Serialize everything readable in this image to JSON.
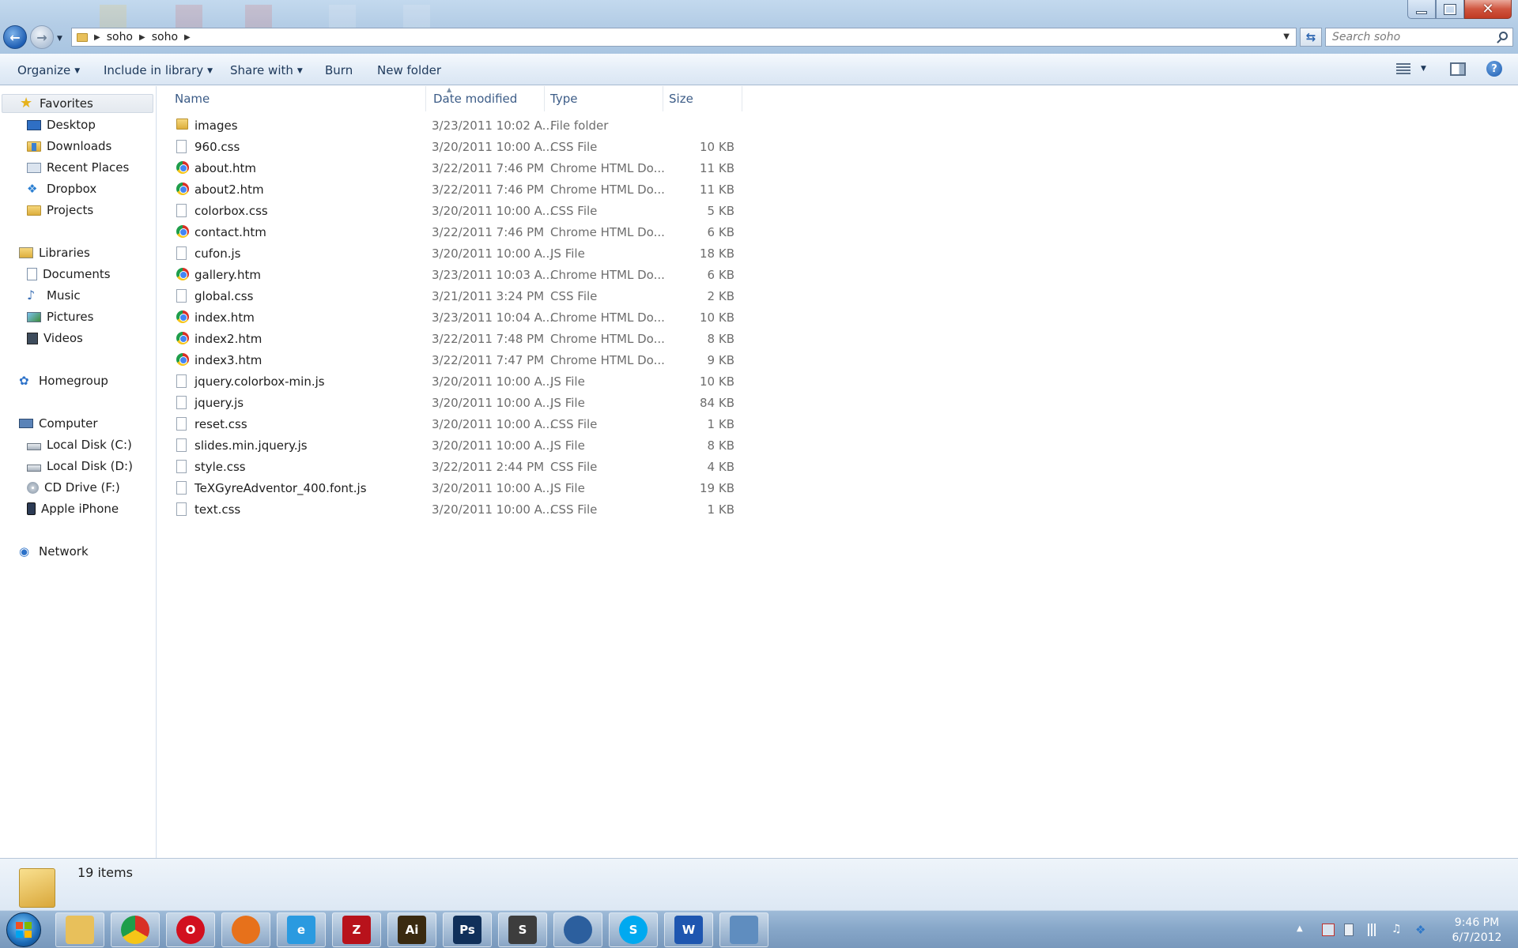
{
  "window": {
    "minimize_icon": "minimize-icon",
    "maximize_icon": "maximize-icon",
    "close_icon": "close-icon"
  },
  "address": {
    "crumbs": [
      "soho",
      "soho"
    ],
    "search_placeholder": "Search soho"
  },
  "toolbar": {
    "organize": "Organize",
    "include_in_library": "Include in library",
    "share_with": "Share with",
    "burn": "Burn",
    "new_folder": "New folder"
  },
  "nav": {
    "favorites": {
      "label": "Favorites",
      "items": [
        "Desktop",
        "Downloads",
        "Recent Places",
        "Dropbox",
        "Projects"
      ]
    },
    "libraries": {
      "label": "Libraries",
      "items": [
        "Documents",
        "Music",
        "Pictures",
        "Videos"
      ]
    },
    "homegroup": "Homegroup",
    "computer": {
      "label": "Computer",
      "items": [
        "Local Disk (C:)",
        "Local Disk (D:)",
        "CD Drive (F:)",
        "Apple iPhone"
      ]
    },
    "network": "Network"
  },
  "columns": {
    "name": "Name",
    "date_modified": "Date modified",
    "type": "Type",
    "size": "Size"
  },
  "files": [
    {
      "name": "images",
      "date": "3/23/2011 10:02 A...",
      "type": "File folder",
      "size": "",
      "icon": "folder-icon"
    },
    {
      "name": "960.css",
      "date": "3/20/2011 10:00 A...",
      "type": "CSS File",
      "size": "10 KB",
      "icon": "file-icon"
    },
    {
      "name": "about.htm",
      "date": "3/22/2011 7:46 PM",
      "type": "Chrome HTML Do...",
      "size": "11 KB",
      "icon": "chrome-icon"
    },
    {
      "name": "about2.htm",
      "date": "3/22/2011 7:46 PM",
      "type": "Chrome HTML Do...",
      "size": "11 KB",
      "icon": "chrome-icon"
    },
    {
      "name": "colorbox.css",
      "date": "3/20/2011 10:00 A...",
      "type": "CSS File",
      "size": "5 KB",
      "icon": "file-icon"
    },
    {
      "name": "contact.htm",
      "date": "3/22/2011 7:46 PM",
      "type": "Chrome HTML Do...",
      "size": "6 KB",
      "icon": "chrome-icon"
    },
    {
      "name": "cufon.js",
      "date": "3/20/2011 10:00 A...",
      "type": "JS File",
      "size": "18 KB",
      "icon": "file-icon"
    },
    {
      "name": "gallery.htm",
      "date": "3/23/2011 10:03 A...",
      "type": "Chrome HTML Do...",
      "size": "6 KB",
      "icon": "chrome-icon"
    },
    {
      "name": "global.css",
      "date": "3/21/2011 3:24 PM",
      "type": "CSS File",
      "size": "2 KB",
      "icon": "file-icon"
    },
    {
      "name": "index.htm",
      "date": "3/23/2011 10:04 A...",
      "type": "Chrome HTML Do...",
      "size": "10 KB",
      "icon": "chrome-icon"
    },
    {
      "name": "index2.htm",
      "date": "3/22/2011 7:48 PM",
      "type": "Chrome HTML Do...",
      "size": "8 KB",
      "icon": "chrome-icon"
    },
    {
      "name": "index3.htm",
      "date": "3/22/2011 7:47 PM",
      "type": "Chrome HTML Do...",
      "size": "9 KB",
      "icon": "chrome-icon"
    },
    {
      "name": "jquery.colorbox-min.js",
      "date": "3/20/2011 10:00 A...",
      "type": "JS File",
      "size": "10 KB",
      "icon": "file-icon"
    },
    {
      "name": "jquery.js",
      "date": "3/20/2011 10:00 A...",
      "type": "JS File",
      "size": "84 KB",
      "icon": "file-icon"
    },
    {
      "name": "reset.css",
      "date": "3/20/2011 10:00 A...",
      "type": "CSS File",
      "size": "1 KB",
      "icon": "file-icon"
    },
    {
      "name": "slides.min.jquery.js",
      "date": "3/20/2011 10:00 A...",
      "type": "JS File",
      "size": "8 KB",
      "icon": "file-icon"
    },
    {
      "name": "style.css",
      "date": "3/22/2011 2:44 PM",
      "type": "CSS File",
      "size": "4 KB",
      "icon": "file-icon"
    },
    {
      "name": "TeXGyreAdventor_400.font.js",
      "date": "3/20/2011 10:00 A...",
      "type": "JS File",
      "size": "19 KB",
      "icon": "file-icon"
    },
    {
      "name": "text.css",
      "date": "3/20/2011 10:00 A...",
      "type": "CSS File",
      "size": "1 KB",
      "icon": "file-icon"
    }
  ],
  "status": {
    "item_count": "19 items"
  },
  "taskbar": {
    "apps": [
      {
        "name": "explorer-icon",
        "color": "#e8c05b",
        "glyph": ""
      },
      {
        "name": "chrome-icon",
        "color": "#2f7a3a",
        "glyph": ""
      },
      {
        "name": "opera-icon",
        "color": "#d2101f",
        "glyph": "O"
      },
      {
        "name": "firefox-icon",
        "color": "#e7711b",
        "glyph": ""
      },
      {
        "name": "internet-explorer-icon",
        "color": "#2a9ae0",
        "glyph": "e"
      },
      {
        "name": "filezilla-icon",
        "color": "#b8121b",
        "glyph": "Z"
      },
      {
        "name": "illustrator-icon",
        "color": "#3a2a10",
        "glyph": "Ai"
      },
      {
        "name": "photoshop-icon",
        "color": "#10305a",
        "glyph": "Ps"
      },
      {
        "name": "sublime-icon",
        "color": "#3d3d3d",
        "glyph": "S"
      },
      {
        "name": "thunderbird-icon",
        "color": "#2c5f9e",
        "glyph": ""
      },
      {
        "name": "skype-icon",
        "color": "#00a9f0",
        "glyph": "S"
      },
      {
        "name": "word-icon",
        "color": "#1e56b0",
        "glyph": "W"
      },
      {
        "name": "photo-viewer-icon",
        "color": "#5f8dbf",
        "glyph": ""
      }
    ],
    "time": "9:46 PM",
    "date": "6/7/2012"
  },
  "colors": {
    "accent": "#1e395b",
    "header_text": "#3c5c87",
    "secondary_text": "#6d6d6d"
  }
}
